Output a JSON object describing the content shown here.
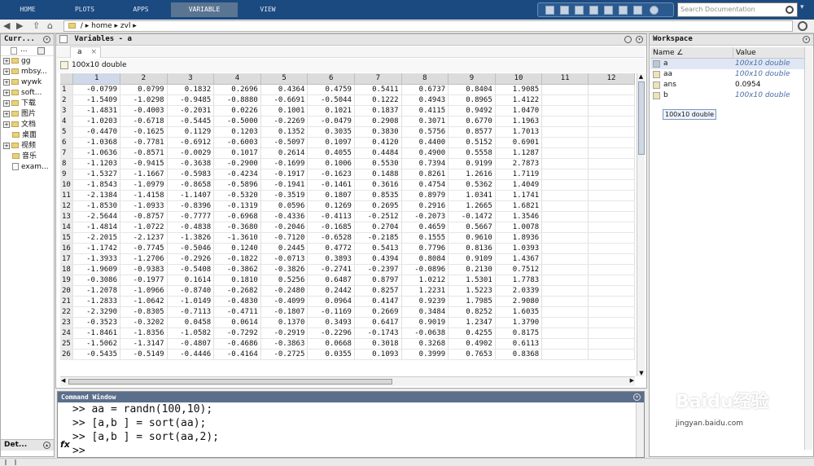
{
  "tabs": [
    {
      "label": "HOME"
    },
    {
      "label": "PLOTS"
    },
    {
      "label": "APPS"
    },
    {
      "label": "VARIABLE"
    },
    {
      "label": "VIEW"
    }
  ],
  "search": {
    "placeholder": "Search Documentation"
  },
  "address": {
    "path": "/ ▸ home ▸ zvl ▸"
  },
  "left_panel": {
    "title": "Curr...",
    "items": [
      {
        "label": "gg",
        "type": "folder",
        "expand": true
      },
      {
        "label": "mbsy...",
        "type": "folder",
        "expand": true
      },
      {
        "label": "wywk",
        "type": "folder",
        "expand": true
      },
      {
        "label": "soft...",
        "type": "folder",
        "expand": true
      },
      {
        "label": "下载",
        "type": "folder",
        "expand": true
      },
      {
        "label": "图片",
        "type": "folder",
        "expand": true
      },
      {
        "label": "文档",
        "type": "folder",
        "expand": true
      },
      {
        "label": "桌面",
        "type": "folder",
        "expand": false
      },
      {
        "label": "视频",
        "type": "folder",
        "expand": true
      },
      {
        "label": "音乐",
        "type": "folder",
        "expand": false
      },
      {
        "label": "exam...",
        "type": "file",
        "expand": false
      }
    ],
    "details": "Det..."
  },
  "variables": {
    "title": "Variables - a",
    "tab": "a",
    "info": "100x10 double",
    "columns": [
      "1",
      "2",
      "3",
      "4",
      "5",
      "6",
      "7",
      "8",
      "9",
      "10",
      "11",
      "12"
    ],
    "rows": [
      [
        "1",
        "-0.0799",
        "0.0799",
        "0.1832",
        "0.2696",
        "0.4364",
        "0.4759",
        "0.5411",
        "0.6737",
        "0.8404",
        "1.9085"
      ],
      [
        "2",
        "-1.5409",
        "-1.0298",
        "-0.9485",
        "-0.8880",
        "-0.6691",
        "-0.5044",
        "0.1222",
        "0.4943",
        "0.8965",
        "1.4122"
      ],
      [
        "3",
        "-1.4831",
        "-0.4003",
        "-0.2031",
        "0.0226",
        "0.1001",
        "0.1021",
        "0.1837",
        "0.4115",
        "0.9492",
        "1.0470"
      ],
      [
        "4",
        "-1.0203",
        "-0.6718",
        "-0.5445",
        "-0.5000",
        "-0.2269",
        "-0.0479",
        "0.2908",
        "0.3071",
        "0.6770",
        "1.1963"
      ],
      [
        "5",
        "-0.4470",
        "-0.1625",
        "0.1129",
        "0.1203",
        "0.1352",
        "0.3035",
        "0.3830",
        "0.5756",
        "0.8577",
        "1.7013"
      ],
      [
        "6",
        "-1.0368",
        "-0.7781",
        "-0.6912",
        "-0.6003",
        "-0.5097",
        "0.1097",
        "0.4120",
        "0.4400",
        "0.5152",
        "0.6901"
      ],
      [
        "7",
        "-1.0636",
        "-0.8571",
        "-0.0029",
        "0.1017",
        "0.2614",
        "0.4055",
        "0.4484",
        "0.4900",
        "0.5558",
        "1.1287"
      ],
      [
        "8",
        "-1.1203",
        "-0.9415",
        "-0.3638",
        "-0.2900",
        "-0.1699",
        "0.1006",
        "0.5530",
        "0.7394",
        "0.9199",
        "2.7873"
      ],
      [
        "9",
        "-1.5327",
        "-1.1667",
        "-0.5983",
        "-0.4234",
        "-0.1917",
        "-0.1623",
        "0.1488",
        "0.8261",
        "1.2616",
        "1.7119"
      ],
      [
        "10",
        "-1.8543",
        "-1.0979",
        "-0.8658",
        "-0.5896",
        "-0.1941",
        "-0.1461",
        "0.3616",
        "0.4754",
        "0.5362",
        "1.4049"
      ],
      [
        "11",
        "-2.1384",
        "-1.4158",
        "-1.1407",
        "-0.5320",
        "-0.3519",
        "0.1807",
        "0.8535",
        "0.8979",
        "1.0341",
        "1.1741"
      ],
      [
        "12",
        "-1.8530",
        "-1.0933",
        "-0.8396",
        "-0.1319",
        "0.0596",
        "0.1269",
        "0.2695",
        "0.2916",
        "1.2665",
        "1.6821"
      ],
      [
        "13",
        "-2.5644",
        "-0.8757",
        "-0.7777",
        "-0.6968",
        "-0.4336",
        "-0.4113",
        "-0.2512",
        "-0.2073",
        "-0.1472",
        "1.3546"
      ],
      [
        "14",
        "-1.4814",
        "-1.0722",
        "-0.4838",
        "-0.3680",
        "-0.2046",
        "-0.1685",
        "0.2704",
        "0.4659",
        "0.5667",
        "1.0078"
      ],
      [
        "15",
        "-2.2015",
        "-2.1237",
        "-1.3826",
        "-1.3610",
        "-0.7120",
        "-0.6528",
        "-0.2185",
        "0.1555",
        "0.9610",
        "1.8936"
      ],
      [
        "16",
        "-1.1742",
        "-0.7745",
        "-0.5046",
        "0.1240",
        "0.2445",
        "0.4772",
        "0.5413",
        "0.7796",
        "0.8136",
        "1.0393"
      ],
      [
        "17",
        "-1.3933",
        "-1.2706",
        "-0.2926",
        "-0.1822",
        "-0.0713",
        "0.3893",
        "0.4394",
        "0.8084",
        "0.9109",
        "1.4367"
      ],
      [
        "18",
        "-1.9609",
        "-0.9383",
        "-0.5408",
        "-0.3862",
        "-0.3826",
        "-0.2741",
        "-0.2397",
        "-0.0896",
        "0.2130",
        "0.7512"
      ],
      [
        "19",
        "-0.3086",
        "-0.1977",
        "0.1614",
        "0.1810",
        "0.5256",
        "0.6487",
        "0.8797",
        "1.0212",
        "1.5301",
        "1.7783"
      ],
      [
        "20",
        "-1.2078",
        "-1.0966",
        "-0.8740",
        "-0.2682",
        "-0.2480",
        "0.2442",
        "0.8257",
        "1.2231",
        "1.5223",
        "2.0339"
      ],
      [
        "21",
        "-1.2833",
        "-1.0642",
        "-1.0149",
        "-0.4830",
        "-0.4099",
        "0.0964",
        "0.4147",
        "0.9239",
        "1.7985",
        "2.9080"
      ],
      [
        "22",
        "-2.3290",
        "-0.8305",
        "-0.7113",
        "-0.4711",
        "-0.1807",
        "-0.1169",
        "0.2669",
        "0.3484",
        "0.8252",
        "1.6035"
      ],
      [
        "23",
        "-0.3523",
        "-0.3202",
        "0.0458",
        "0.0614",
        "0.1370",
        "0.3493",
        "0.6417",
        "0.9019",
        "1.2347",
        "1.3790"
      ],
      [
        "24",
        "-1.8461",
        "-1.8356",
        "-1.0582",
        "-0.7292",
        "-0.2919",
        "-0.2296",
        "-0.1743",
        "-0.0638",
        "0.4255",
        "0.8175"
      ],
      [
        "25",
        "-1.5062",
        "-1.3147",
        "-0.4807",
        "-0.4686",
        "-0.3863",
        "0.0668",
        "0.3018",
        "0.3268",
        "0.4902",
        "0.6113"
      ],
      [
        "26",
        "-0.5435",
        "-0.5149",
        "-0.4446",
        "-0.4164",
        "-0.2725",
        "0.0355",
        "0.1093",
        "0.3999",
        "0.7653",
        "0.8368"
      ]
    ]
  },
  "command_window": {
    "title": "Command Window",
    "lines": [
      ">> aa = randn(100,10);",
      ">> [a,b ] = sort(aa);",
      ">> [a,b ] = sort(aa,2);"
    ],
    "prompt": ">>"
  },
  "workspace": {
    "title": "Workspace",
    "headers": {
      "name": "Name ∠",
      "value": "Value"
    },
    "items": [
      {
        "name": "a",
        "value": "100x10 double",
        "italic": true
      },
      {
        "name": "aa",
        "value": "100x10 double",
        "italic": true
      },
      {
        "name": "ans",
        "value": "0.0954",
        "italic": false
      },
      {
        "name": "b",
        "value": "100x10 double",
        "italic": true
      }
    ],
    "tooltip": "100x10 double"
  },
  "watermark": {
    "text": "Baidu经验",
    "sub": "jingyan.baidu.com"
  }
}
